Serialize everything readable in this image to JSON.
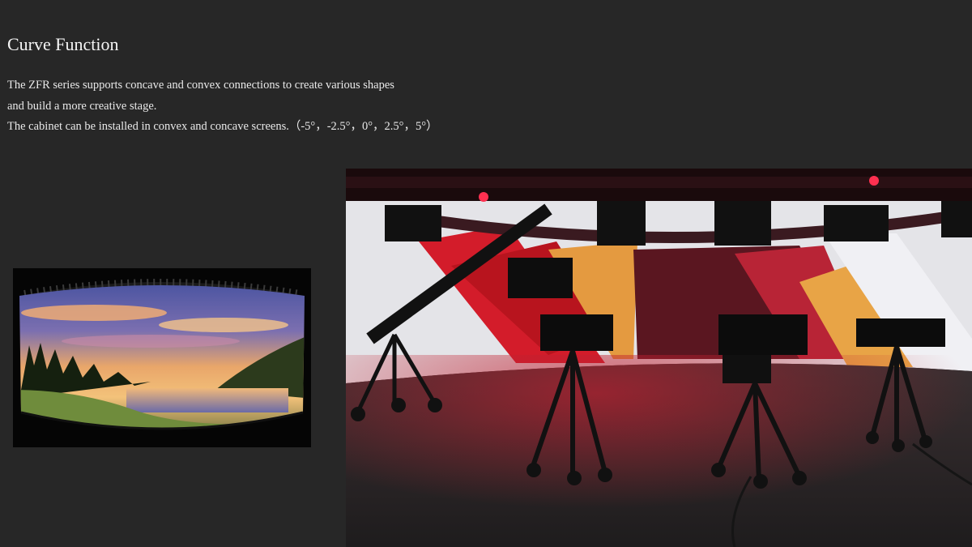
{
  "slide": {
    "title": "Curve Function",
    "lines": [
      "The ZFR series supports concave and convex connections to create various shapes",
      "and build a more creative stage.",
      "The cabinet can be installed in convex and concave screens.（-5°，-2.5°，0°，2.5°，5°）"
    ]
  },
  "images": {
    "left": {
      "icon": "cylindrical-led-screen-photo",
      "colors": {
        "sky_top": "#4a5aa8",
        "sunset": "#f0a060",
        "grass": "#6d8a3a"
      }
    },
    "right": {
      "icon": "tv-studio-curved-led-photo",
      "colors": {
        "screen_red": "#d0202c",
        "cone": "#e8a040",
        "marble": "#e6e6ea"
      }
    }
  }
}
